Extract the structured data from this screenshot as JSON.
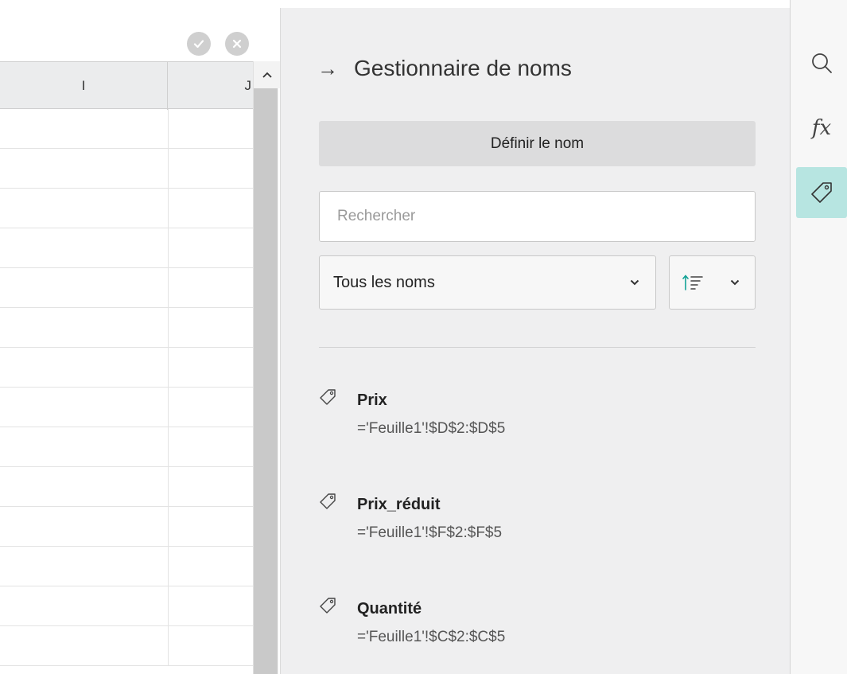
{
  "sheet": {
    "columns": [
      "I",
      "J"
    ],
    "row_count": 14
  },
  "panel": {
    "title": "Gestionnaire de noms",
    "define_label": "Définir le nom",
    "search_placeholder": "Rechercher",
    "filter_value": "Tous les noms",
    "names": [
      {
        "name": "Prix",
        "ref": "='Feuille1'!$D$2:$D$5"
      },
      {
        "name": "Prix_réduit",
        "ref": "='Feuille1'!$F$2:$F$5"
      },
      {
        "name": "Quantité",
        "ref": "='Feuille1'!$C$2:$C$5"
      }
    ]
  },
  "rail": {
    "fx_label": "fx",
    "active_color": "#b7e5e1"
  },
  "colors": {
    "accent": "#12a296",
    "panel_bg": "#efeff0"
  },
  "icons": {
    "confirm": "check-circle-icon",
    "cancel": "close-circle-icon",
    "search": "search-icon",
    "tag": "tag-icon",
    "sort": "sort-ascending-icon"
  }
}
